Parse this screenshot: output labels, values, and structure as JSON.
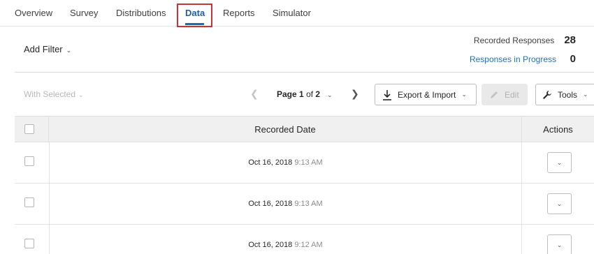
{
  "nav": {
    "tabs": [
      {
        "label": "Overview"
      },
      {
        "label": "Survey"
      },
      {
        "label": "Distributions"
      },
      {
        "label": "Data"
      },
      {
        "label": "Reports"
      },
      {
        "label": "Simulator"
      }
    ],
    "active_tab": "Data"
  },
  "filter": {
    "add_filter_label": "Add Filter"
  },
  "stats": {
    "recorded_label": "Recorded Responses",
    "recorded_value": "28",
    "in_progress_label": "Responses in Progress",
    "in_progress_value": "0"
  },
  "toolbar": {
    "with_selected_label": "With Selected",
    "page_prefix": "Page",
    "page_current": "1",
    "page_of": "of",
    "page_total": "2",
    "export_label": "Export & Import",
    "edit_label": "Edit",
    "tools_label": "Tools"
  },
  "table": {
    "columns": {
      "date": "Recorded Date",
      "actions": "Actions"
    },
    "rows": [
      {
        "date": "Oct 16, 2018",
        "time": "9:13 AM"
      },
      {
        "date": "Oct 16, 2018",
        "time": "9:13 AM"
      },
      {
        "date": "Oct 16, 2018",
        "time": "9:12 AM"
      }
    ]
  },
  "colors": {
    "active_tab": "#1f5f9e",
    "highlight_box": "#c9313b",
    "link": "#1a73c7"
  },
  "icons": {
    "export": "download-icon",
    "edit": "pencil-icon",
    "tools": "wrench-icon"
  }
}
